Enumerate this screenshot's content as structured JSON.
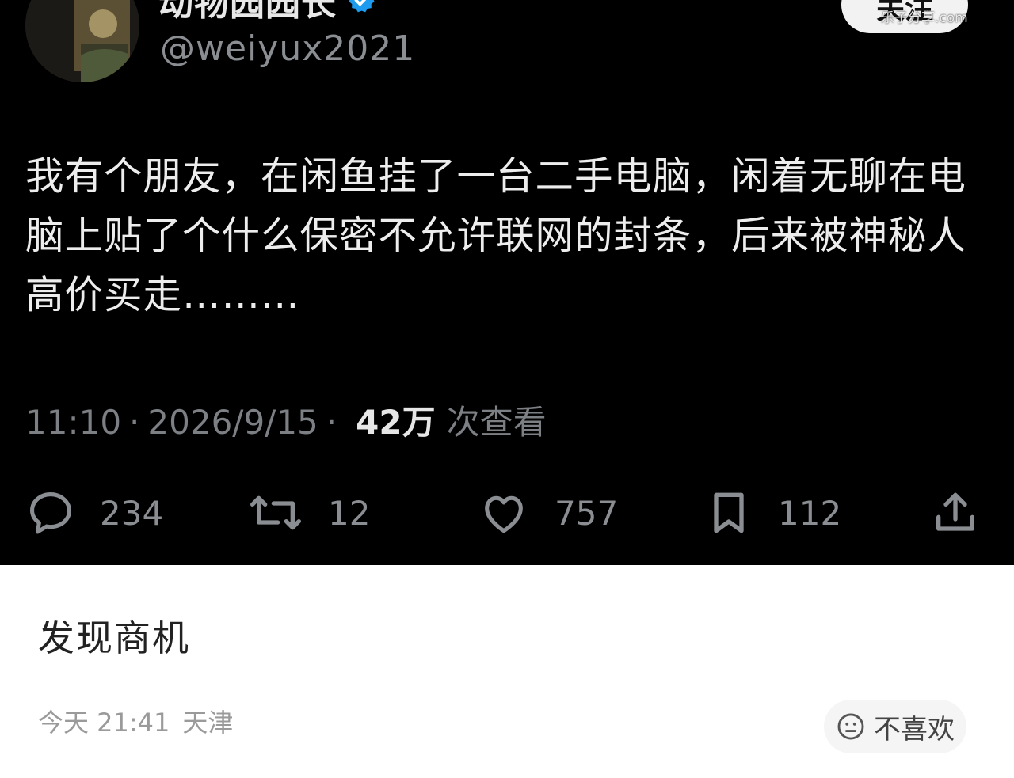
{
  "tweet": {
    "display_name": "动物园园长",
    "handle": "@weiyux2021",
    "follow_label": "关注",
    "watermark": "乐子分享.com",
    "text": "我有个朋友，在闲鱼挂了一台二手电脑，闲着无聊在电脑上贴了个什么保密不允许联网的封条，后来被神秘人高价买走………",
    "time": "11:10",
    "date": "2026/9/15",
    "views_count": "42万",
    "views_label": "次查看",
    "actions": {
      "reply_count": "234",
      "retweet_count": "12",
      "like_count": "757",
      "bookmark_count": "112"
    },
    "colors": {
      "background": "#000000",
      "verified": "#1d9bf0"
    }
  },
  "post": {
    "caption": "发现商机",
    "timestamp": "今天 21:41",
    "location": "天津",
    "dislike_label": "不喜欢"
  }
}
